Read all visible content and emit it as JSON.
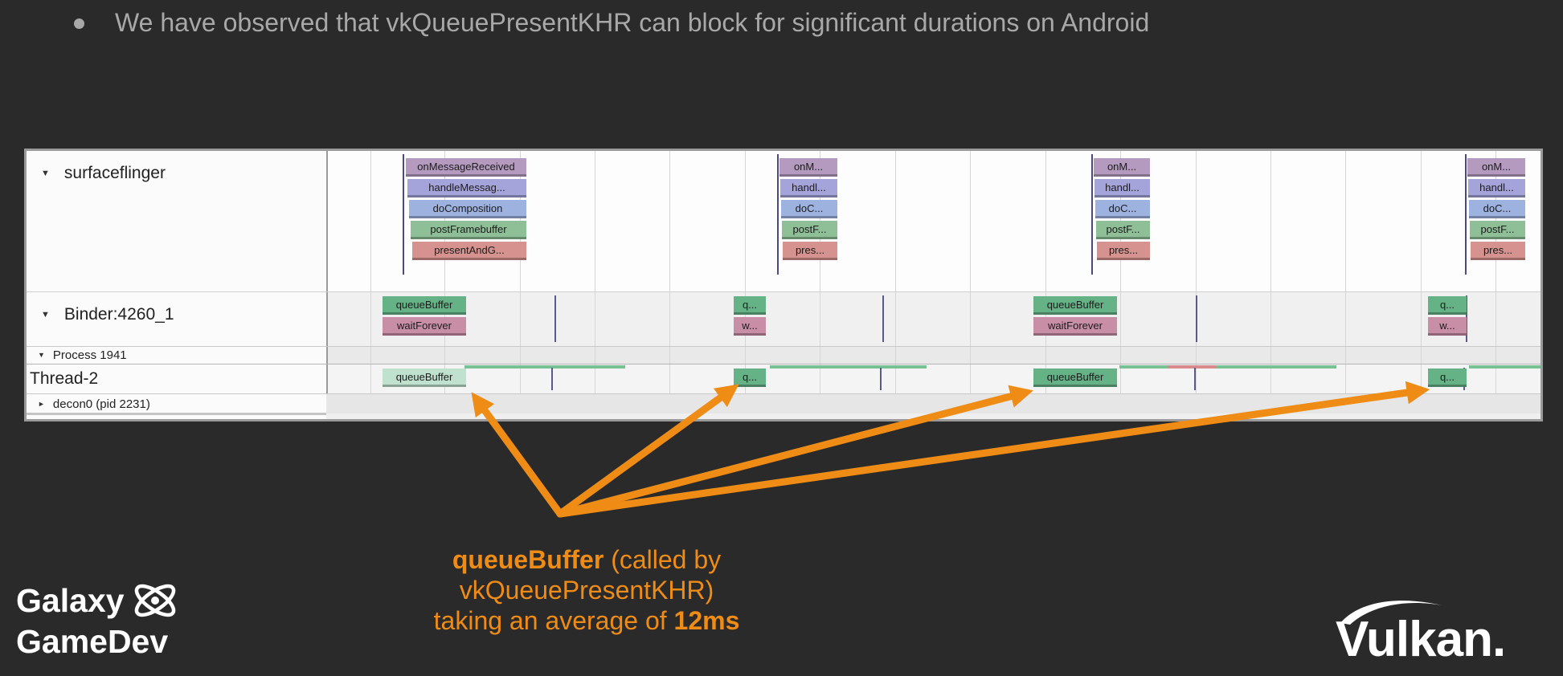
{
  "slide": {
    "bullet": "We have observed that vkQueuePresentKHR can block for significant durations on Android"
  },
  "trace": {
    "tracks": [
      {
        "name": "surfaceflinger"
      },
      {
        "name": "Binder:4260_1"
      },
      {
        "name": "Process 1941"
      },
      {
        "name": "Thread-2"
      },
      {
        "name": "decon0 (pid 2231)"
      }
    ],
    "surfaceflinger_groups": [
      {
        "labels": [
          "onMessageReceived",
          "handleMessag...",
          "doComposition",
          "postFramebuffer",
          "presentAndG..."
        ]
      },
      {
        "labels": [
          "onM...",
          "handl...",
          "doC...",
          "postF...",
          "pres..."
        ]
      },
      {
        "labels": [
          "onM...",
          "handl...",
          "doC...",
          "postF...",
          "pres..."
        ]
      },
      {
        "labels": [
          "onM...",
          "handl...",
          "doC...",
          "postF...",
          "pres..."
        ]
      }
    ],
    "binder_groups": [
      {
        "labels": [
          "queueBuffer",
          "waitForever"
        ]
      },
      {
        "labels": [
          "q...",
          "w..."
        ]
      },
      {
        "labels": [
          "queueBuffer",
          "waitForever"
        ]
      },
      {
        "labels": [
          "q...",
          "w..."
        ]
      }
    ],
    "thread_slices": [
      {
        "label": "queueBuffer"
      },
      {
        "label": "q..."
      },
      {
        "label": "queueBuffer"
      },
      {
        "label": "q..."
      }
    ]
  },
  "caption": {
    "line1_bold": "queueBuffer",
    "line1_rest": " (called by",
    "line2": "vkQueuePresentKHR)",
    "line3_rest": "taking an average of ",
    "line3_bold": "12ms"
  },
  "branding": {
    "galaxy_line1": "Galaxy",
    "galaxy_line2": "GameDev",
    "vulkan": "Vulkan."
  },
  "colors": {
    "background": "#2a2a2a",
    "accent_orange": "#ef8c16",
    "bullet_text": "#a8a8a8"
  },
  "icons": [
    "bullet-dot",
    "galaxy-atom-icon",
    "vulkan-swoosh-icon",
    "expand-triangle-icon"
  ]
}
